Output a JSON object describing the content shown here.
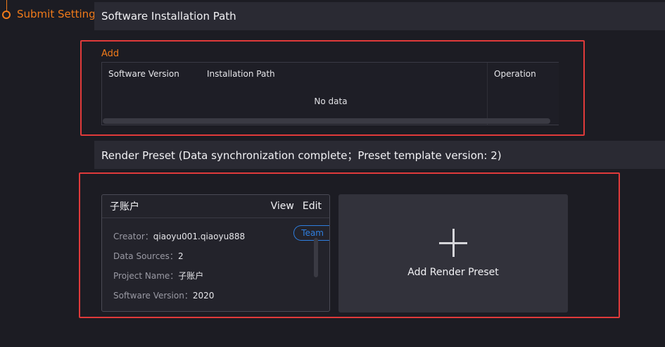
{
  "nav": {
    "label": "Submit Settings"
  },
  "software_section": {
    "title": "Software Installation Path",
    "add_label": "Add",
    "table": {
      "columns": [
        "Software Version",
        "Installation Path",
        "Operation"
      ],
      "empty_text": "No data"
    }
  },
  "preset_section": {
    "title": "Render Preset (Data synchronization complete；Preset template version: 2)",
    "card": {
      "title": "子账户",
      "view_label": "View",
      "edit_label": "Edit",
      "badge": "Team",
      "fields": [
        {
          "label": "Creator：",
          "value": "qiaoyu001.qiaoyu888"
        },
        {
          "label": "Data Sources：",
          "value": "2"
        },
        {
          "label": "Project Name：",
          "value": "子账户"
        },
        {
          "label": "Software Version：",
          "value": "2020"
        }
      ]
    },
    "add_preset_label": "Add Render Preset"
  },
  "colors": {
    "accent": "#f07a1a",
    "highlight": "#e03a3a",
    "badge": "#2f7fe0"
  },
  "icons": {
    "plus": "plus-icon"
  }
}
